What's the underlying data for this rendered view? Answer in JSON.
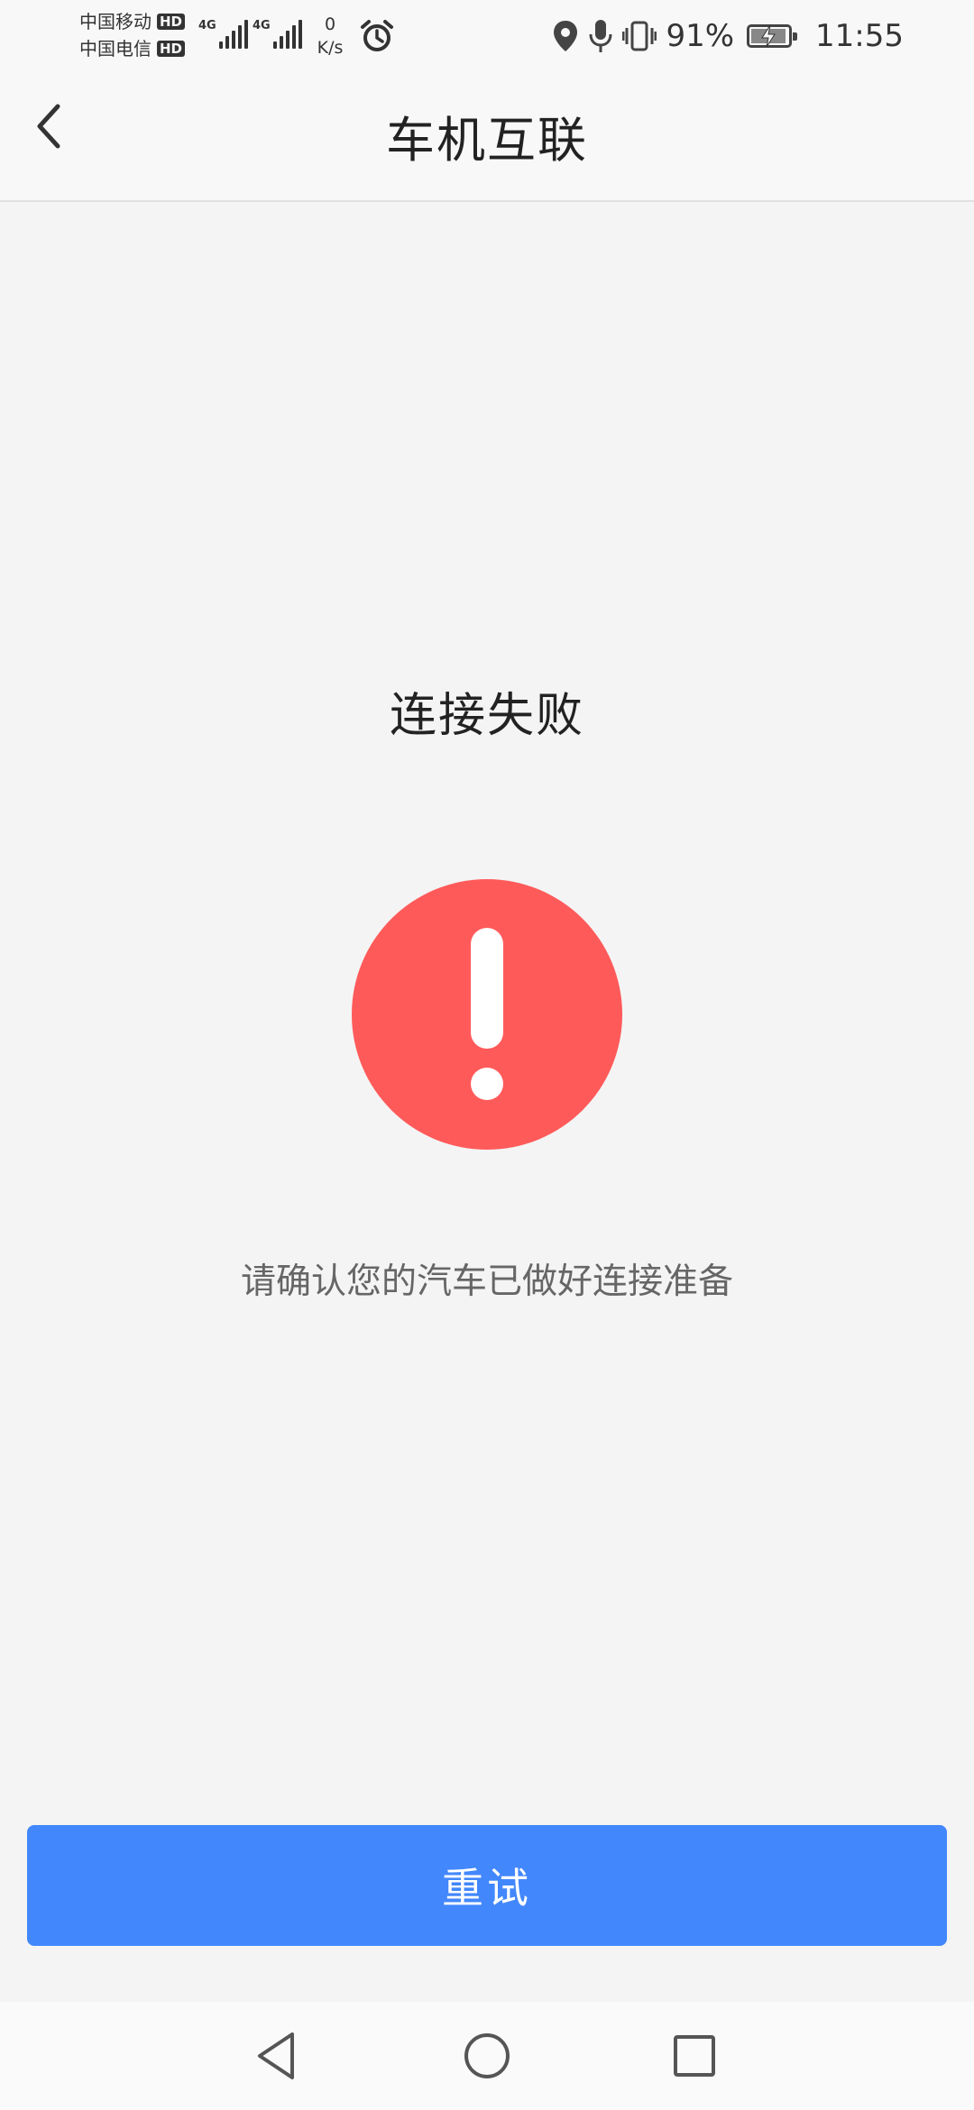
{
  "status_bar": {
    "carrier_1": "中国移动",
    "carrier_2": "中国电信",
    "hd_badge": "HD",
    "network_type": "4G",
    "speed_value": "0",
    "speed_unit": "K/s",
    "battery_percent": "91%",
    "time": "11:55"
  },
  "header": {
    "title": "车机互联"
  },
  "content": {
    "status_title": "连接失败",
    "hint": "请确认您的汽车已做好连接准备"
  },
  "actions": {
    "retry_label": "重试"
  },
  "colors": {
    "error_red": "#ff5a5a",
    "primary_blue": "#4287fc",
    "background": "#f4f4f4"
  },
  "icons": [
    "back-arrow-icon",
    "error-exclamation-icon",
    "alarm-icon",
    "location-icon",
    "microphone-icon",
    "vibrate-icon",
    "battery-charging-icon",
    "nav-back-icon",
    "nav-home-icon",
    "nav-recent-icon"
  ]
}
